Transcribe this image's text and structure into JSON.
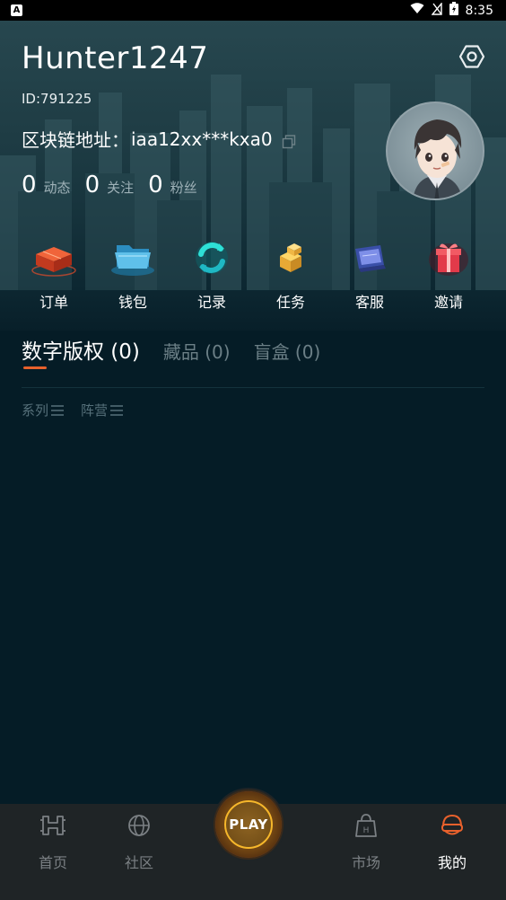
{
  "status_bar": {
    "time": "8:35",
    "app_letter": "A"
  },
  "profile": {
    "username": "Hunter1247",
    "id_text": "ID:791225",
    "chain_label": "区块链地址：",
    "chain_address": "iaa12xx***kxa0",
    "stats": [
      {
        "value": "0",
        "label": "动态"
      },
      {
        "value": "0",
        "label": "关注"
      },
      {
        "value": "0",
        "label": "粉丝"
      }
    ]
  },
  "quick_actions": [
    {
      "label": "订单",
      "icon": "order-box-icon"
    },
    {
      "label": "钱包",
      "icon": "wallet-folder-icon"
    },
    {
      "label": "记录",
      "icon": "record-refresh-icon"
    },
    {
      "label": "任务",
      "icon": "task-cubes-icon"
    },
    {
      "label": "客服",
      "icon": "service-screen-icon"
    },
    {
      "label": "邀请",
      "icon": "invite-gift-icon"
    }
  ],
  "tabs": [
    {
      "label": "数字版权 (0)",
      "active": true
    },
    {
      "label": "藏品 (0)",
      "active": false
    },
    {
      "label": "盲盒 (0)",
      "active": false
    }
  ],
  "filters": [
    {
      "label": "系列",
      "icon": "menu-lines-icon"
    },
    {
      "label": "阵营",
      "icon": "menu-lines-icon"
    }
  ],
  "bottom_nav": {
    "items": [
      {
        "label": "首页",
        "icon": "home-h-icon",
        "active": false
      },
      {
        "label": "社区",
        "icon": "globe-icon",
        "active": false
      },
      {
        "label": "市场",
        "icon": "market-bag-icon",
        "active": false
      },
      {
        "label": "我的",
        "icon": "profile-helmet-icon",
        "active": true
      }
    ],
    "play_label": "PLAY"
  },
  "colors": {
    "accent": "#e8612c",
    "background": "#051c26",
    "nav_bg": "#1f2426"
  }
}
